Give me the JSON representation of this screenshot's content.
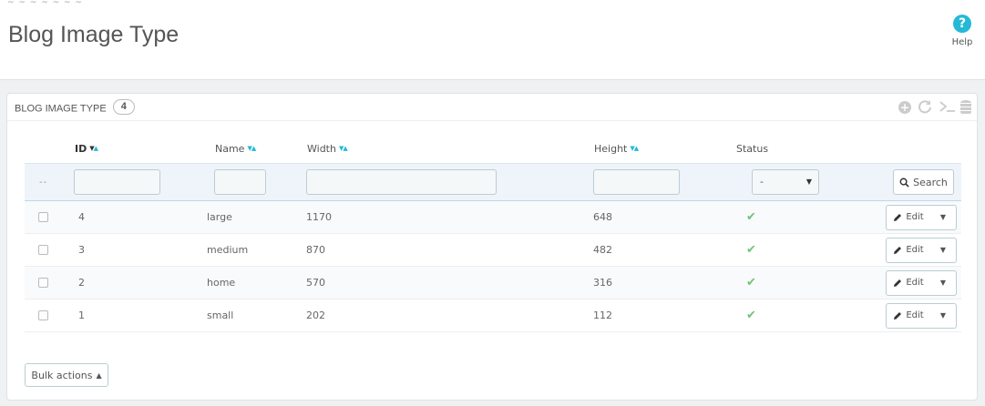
{
  "header": {
    "breadcrumb": "~ ~ ~ ~ ~ ~ ~",
    "title": "Blog Image Type",
    "help_label": "Help"
  },
  "panel": {
    "title": "Blog Image Type",
    "count": "4"
  },
  "table": {
    "columns": [
      "ID",
      "Name",
      "Width",
      "Height",
      "Status"
    ],
    "filter": {
      "row_prefix": "--",
      "status_value": "-",
      "search_label": "Search"
    },
    "rows": [
      {
        "id": "4",
        "name": "large",
        "width": "1170",
        "height": "648",
        "status": "enabled"
      },
      {
        "id": "3",
        "name": "medium",
        "width": "870",
        "height": "482",
        "status": "enabled"
      },
      {
        "id": "2",
        "name": "home",
        "width": "570",
        "height": "316",
        "status": "enabled"
      },
      {
        "id": "1",
        "name": "small",
        "width": "202",
        "height": "112",
        "status": "enabled"
      }
    ],
    "edit_label": "Edit"
  },
  "footer": {
    "bulk_label": "Bulk actions"
  },
  "colors": {
    "accent": "#25b9d7",
    "enabled_check": "#72c279"
  },
  "icons": {
    "help": "question-circle-icon",
    "add": "plus-circle-icon",
    "refresh": "refresh-icon",
    "sql": "terminal-icon",
    "export": "database-icon",
    "search": "search-icon",
    "edit": "pencil-icon",
    "check": "check-icon"
  }
}
